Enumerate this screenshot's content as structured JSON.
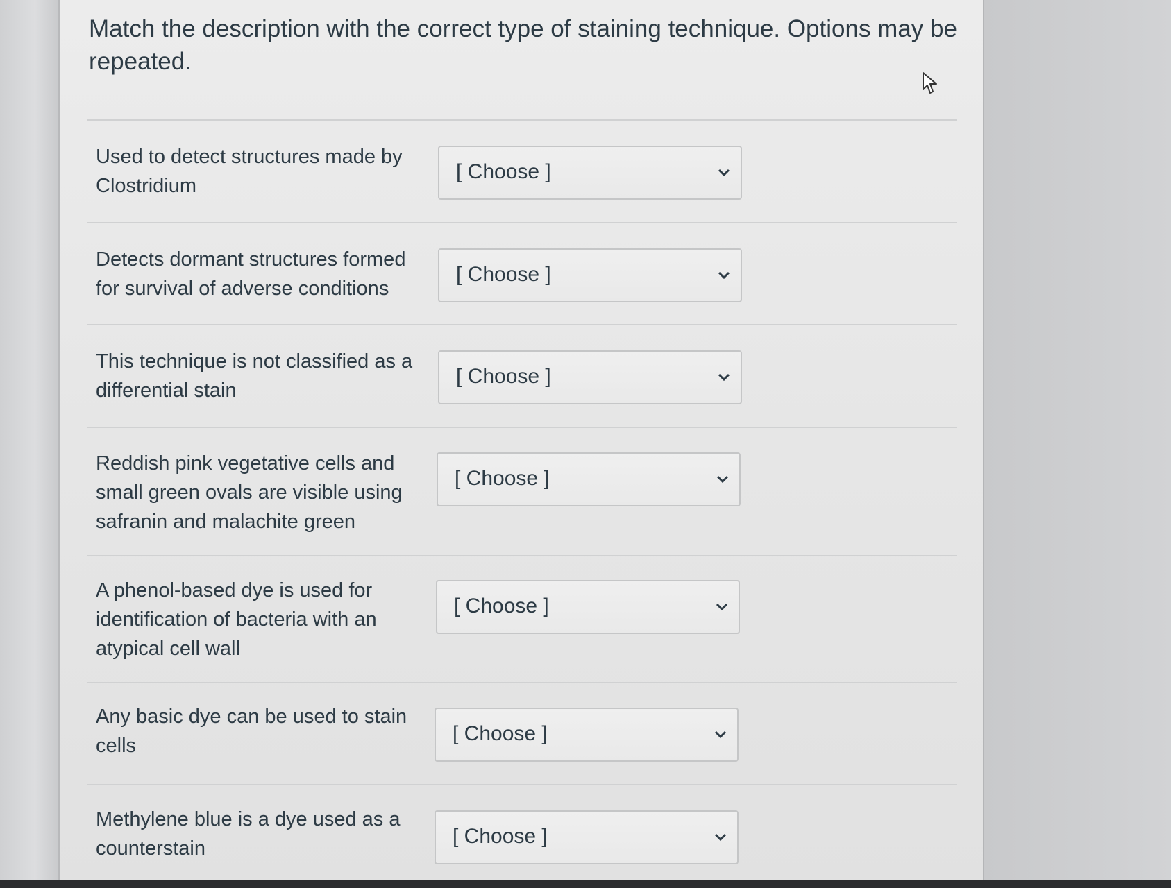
{
  "question": {
    "text": "Match the description with the correct type of staining technique. Options may be repeated."
  },
  "rows": [
    {
      "description": "Used to detect structures made by Clostridium",
      "selected": "[ Choose ]"
    },
    {
      "description": "Detects dormant structures formed for survival of adverse conditions",
      "selected": "[ Choose ]"
    },
    {
      "description": "This technique is not classified as a differential stain",
      "selected": "[ Choose ]"
    },
    {
      "description": "Reddish pink vegetative cells and small green ovals are visible using safranin and malachite green",
      "selected": "[ Choose ]"
    },
    {
      "description": "A phenol-based dye is used for identification of bacteria with an atypical cell wall",
      "selected": "[ Choose ]"
    },
    {
      "description": "Any basic dye can be used to stain cells",
      "selected": "[ Choose ]"
    },
    {
      "description": "Methylene blue is a dye used as a counterstain",
      "selected": "[ Choose ]"
    }
  ],
  "icons": {
    "dropdown": "chevron-down-icon",
    "pointer": "mouse-cursor-icon"
  },
  "colors": {
    "text": "#2d3b45",
    "background": "#e8e8e8",
    "border": "#c5c6c7"
  }
}
